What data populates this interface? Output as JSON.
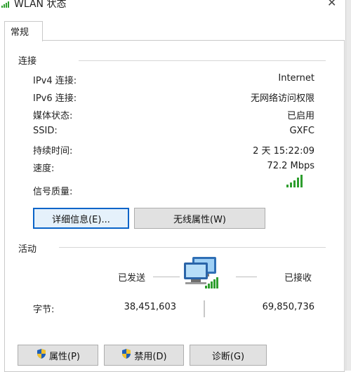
{
  "window": {
    "title": "WLAN 状态",
    "close_glyph": "✕"
  },
  "tabs": [
    {
      "label": "常规"
    }
  ],
  "connection": {
    "heading": "连接",
    "rows": [
      {
        "label": "IPv4 连接:",
        "value": "Internet"
      },
      {
        "label": "IPv6 连接:",
        "value": "无网络访问权限"
      },
      {
        "label": "媒体状态:",
        "value": "已启用"
      },
      {
        "label": "SSID:",
        "value": "GXFC"
      },
      {
        "label": "持续时间:",
        "value": "2 天 15:22:09"
      },
      {
        "label": "速度:",
        "value": "72.2 Mbps"
      }
    ],
    "signal": {
      "label": "信号质量:",
      "icon": "signal-bars-icon",
      "bars_filled": 5,
      "bars_total": 5
    }
  },
  "buttons": {
    "details": "详细信息(E)...",
    "wireless_props": "无线属性(W)"
  },
  "activity": {
    "heading": "活动",
    "sent_label": "已发送",
    "received_label": "已接收",
    "bytes_label": "字节:",
    "bytes_sent": "38,451,603",
    "bytes_received": "69,850,736",
    "icon": "network-computers-icon"
  },
  "bottom_buttons": {
    "properties": "属性(P)",
    "disable": "禁用(D)",
    "diagnose": "诊断(G)"
  },
  "colors": {
    "accent": "#0a64c8",
    "signal": "#2e9e2e",
    "button_bg": "#e1e1e1"
  }
}
